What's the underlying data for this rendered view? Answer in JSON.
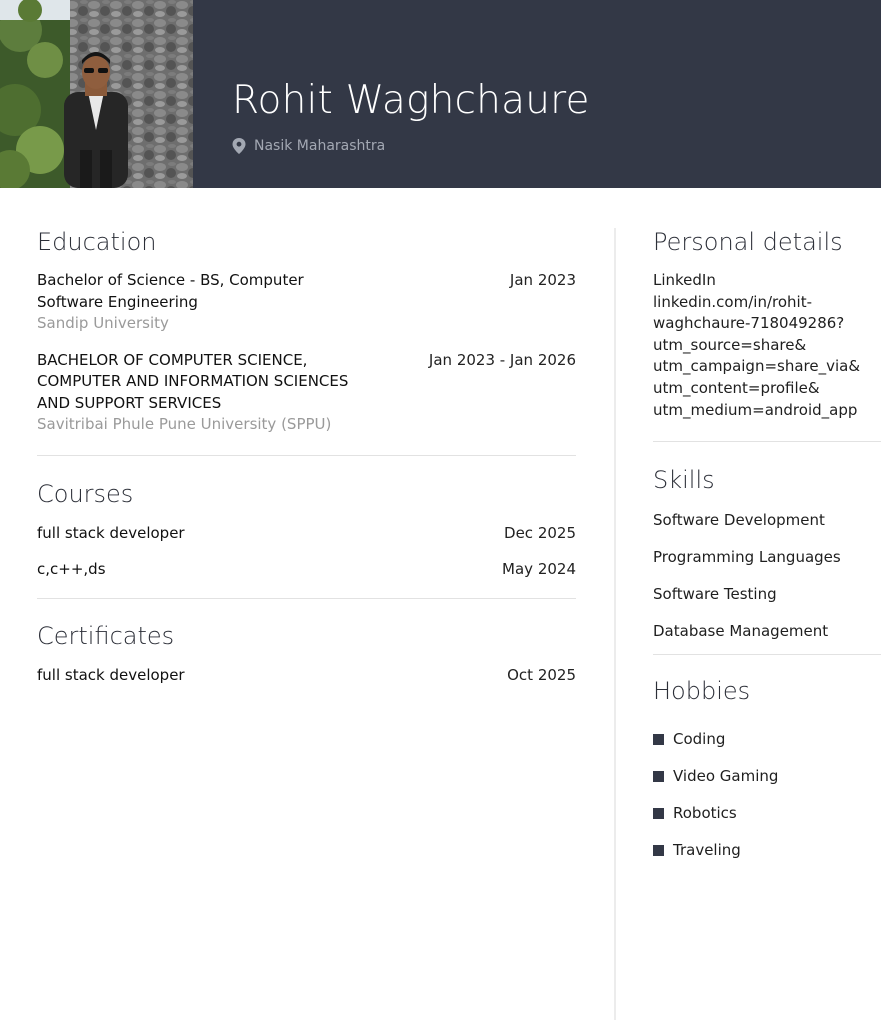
{
  "header": {
    "name": "Rohit Waghchaure",
    "location": "Nasik Maharashtra",
    "location_icon": "map-pin-icon",
    "photo": "profile-photo"
  },
  "colors": {
    "header_bg": "#333846",
    "muted_text": "#9a9a9a",
    "accent": "#333846"
  },
  "education": {
    "title": "Education",
    "items": [
      {
        "degree_lines": [
          "Bachelor of Science - BS, Computer",
          "Software Engineering"
        ],
        "school": "Sandip University",
        "date": "Jan 2023"
      },
      {
        "degree_lines": [
          "BACHELOR OF COMPUTER SCIENCE,",
          "COMPUTER AND INFORMATION SCIENCES",
          "AND SUPPORT SERVICES"
        ],
        "school": "Savitribai Phule Pune University (SPPU)",
        "date": "Jan 2023 - Jan 2026"
      }
    ]
  },
  "courses": {
    "title": "Courses",
    "items": [
      {
        "name": "full stack developer",
        "date": "Dec 2025"
      },
      {
        "name": "c,c++,ds",
        "date": "May 2024"
      }
    ]
  },
  "certificates": {
    "title": "Certificates",
    "items": [
      {
        "name": "full stack developer",
        "date": "Oct 2025"
      }
    ]
  },
  "personal": {
    "title": "Personal details",
    "label": "LinkedIn",
    "lines": [
      "linkedin.com/in/rohit-",
      "waghchaure-718049286?",
      "utm_source=share&",
      "utm_campaign=share_via&",
      "utm_content=profile&",
      "utm_medium=android_app"
    ]
  },
  "skills": {
    "title": "Skills",
    "items": [
      "Software Development",
      "Programming Languages",
      "Software Testing",
      "Database Management"
    ]
  },
  "hobbies": {
    "title": "Hobbies",
    "items": [
      "Coding",
      "Video Gaming",
      "Robotics",
      "Traveling"
    ]
  }
}
